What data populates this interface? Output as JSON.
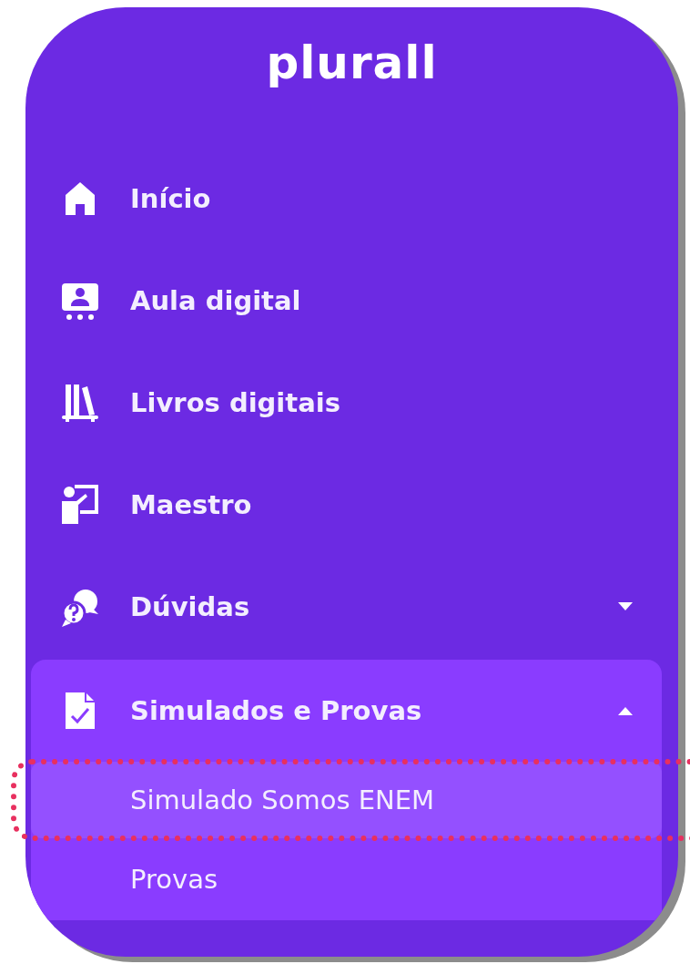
{
  "logo": "plurall",
  "nav": {
    "items": [
      {
        "label": "Início"
      },
      {
        "label": "Aula digital"
      },
      {
        "label": "Livros digitais"
      },
      {
        "label": "Maestro"
      },
      {
        "label": "Dúvidas",
        "expanded": false
      },
      {
        "label": "Simulados e Provas",
        "expanded": true,
        "children": [
          {
            "label": "Simulado Somos ENEM",
            "selected": true,
            "highlighted": true
          },
          {
            "label": "Provas",
            "selected": false,
            "highlighted": false
          }
        ]
      }
    ]
  }
}
